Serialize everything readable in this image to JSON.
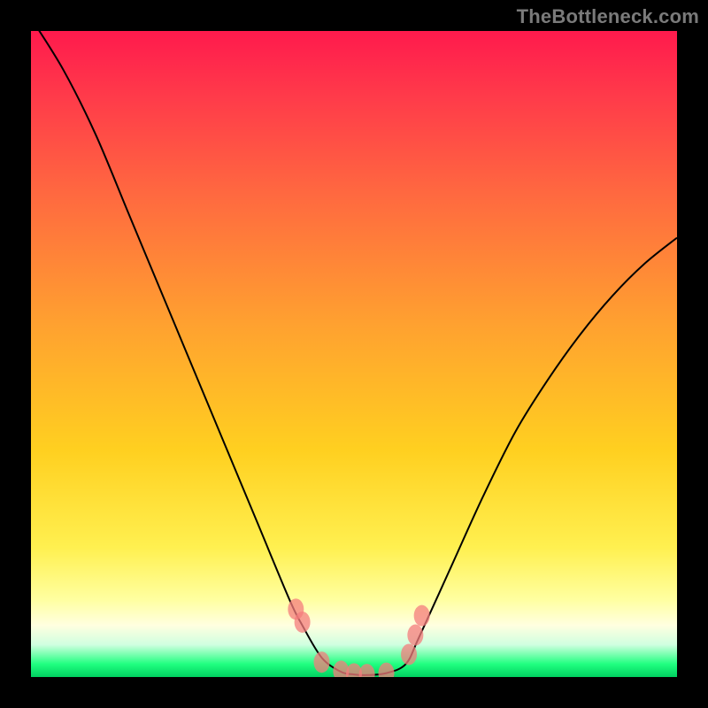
{
  "watermark": "TheBottleneck.com",
  "colors": {
    "frame_bg": "#000000",
    "gradient_top": "#ff1a4d",
    "gradient_bottom": "#00d060",
    "curve": "#000000",
    "marker": "#f47c7c"
  },
  "chart_data": {
    "type": "line",
    "title": "",
    "xlabel": "",
    "ylabel": "",
    "xlim": [
      0,
      100
    ],
    "ylim": [
      0,
      100
    ],
    "curve": {
      "x": [
        0,
        5,
        10,
        15,
        20,
        25,
        30,
        35,
        40,
        42,
        45,
        48,
        50,
        52,
        55,
        58,
        60,
        65,
        70,
        75,
        80,
        85,
        90,
        95,
        100
      ],
      "y_pct": [
        102,
        94,
        84,
        72,
        60,
        48,
        36,
        24,
        12,
        8,
        3,
        0.8,
        0.4,
        0.3,
        0.6,
        2,
        6,
        17,
        28,
        38,
        46,
        53,
        59,
        64,
        68
      ]
    },
    "markers": {
      "x": [
        41,
        42,
        45,
        48,
        50,
        52,
        55,
        58.5,
        59.5,
        60.5
      ],
      "y_pct": [
        10.5,
        8.5,
        2.3,
        0.9,
        0.5,
        0.4,
        0.6,
        3.5,
        6.5,
        9.5
      ]
    }
  }
}
